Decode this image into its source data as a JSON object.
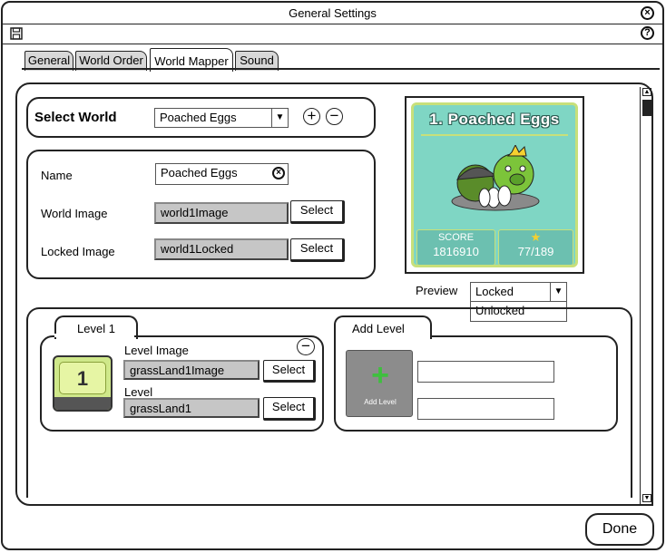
{
  "window": {
    "title": "General Settings"
  },
  "tabs": [
    {
      "label": "General"
    },
    {
      "label": "World Order"
    },
    {
      "label": "World Mapper"
    },
    {
      "label": "Sound"
    }
  ],
  "select_world": {
    "label": "Select World",
    "value": "Poached Eggs"
  },
  "world_form": {
    "name_label": "Name",
    "name_value": "Poached Eggs",
    "world_image_label": "World Image",
    "world_image_value": "world1Image",
    "locked_image_label": "Locked Image",
    "locked_image_value": "world1Locked",
    "select_label": "Select"
  },
  "preview_card": {
    "title": "1. Poached Eggs",
    "score_label": "SCORE",
    "score_value": "1816910",
    "stars_value": "77/189"
  },
  "preview": {
    "label": "Preview",
    "selected": "Locked",
    "options": [
      "Unlocked"
    ]
  },
  "level_card": {
    "tab_label": "Level 1",
    "tile_number": "1",
    "level_image_label": "Level Image",
    "level_image_value": "grassLand1Image",
    "level_label": "Level",
    "level_value": "grassLand1",
    "select_label": "Select"
  },
  "add_level": {
    "tab_label": "Add Level",
    "tile_caption": "Add Level"
  },
  "footer": {
    "done_label": "Done"
  },
  "colors": {
    "panel_border": "#222222",
    "tile_green": "#cfe88a",
    "preview_bg": "#7fd6c4"
  }
}
